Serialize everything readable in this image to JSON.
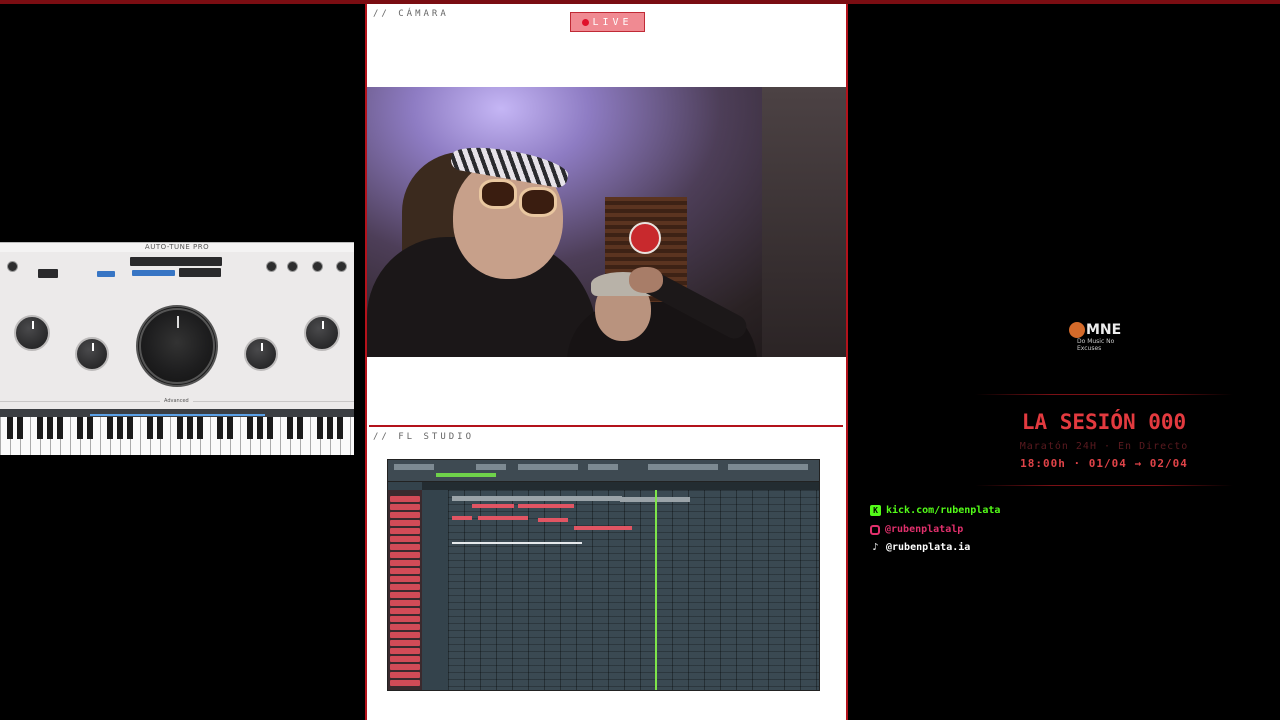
{
  "overlay": {
    "camera_section_label": "// CÁMARA",
    "fl_section_label": "// FL STUDIO",
    "live_label": "LIVE"
  },
  "plugin": {
    "title": "AUTO-TUNE PRO",
    "advanced_label": "Advanced"
  },
  "logo": {
    "mark": "MNE",
    "subtitle": "Do Music No Excuses"
  },
  "session": {
    "title": "LA SESIÓN 000",
    "subtitle": "Maratón 24H · En Directo",
    "date": "18:00h · 01/04 → 02/04"
  },
  "socials": [
    {
      "icon": "kick-icon",
      "text": "kick.com/rubenplata",
      "color": "#53fc18"
    },
    {
      "icon": "instagram-icon",
      "text": "@rubenplatalp",
      "color": "#e1306c"
    },
    {
      "icon": "tiktok-icon",
      "text": "@rubenplata.ia",
      "color": "#ffffff"
    }
  ],
  "colors": {
    "accent_red": "#b3121b",
    "live_badge": "#f08a92",
    "title_red": "#e33a3f"
  }
}
